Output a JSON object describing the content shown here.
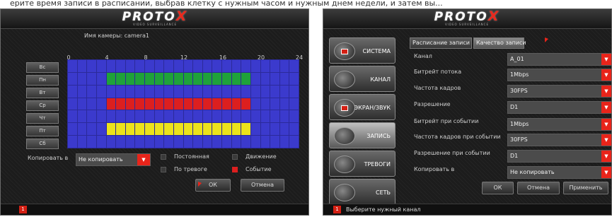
{
  "caption": "ерите время записи в расписании, выбрав клетку с нужным часом и нужным днем недели, и затем вы...",
  "brand": {
    "name": "PROTO",
    "mark": "X",
    "tagline": "VIDEO SURVEILLANCE"
  },
  "schedule_panel": {
    "camera_label": "Имя камеры: camera1",
    "hours": [
      "0",
      "4",
      "8",
      "12",
      "16",
      "20",
      "24"
    ],
    "days": [
      "Вс",
      "Пн",
      "Вт",
      "Ср",
      "Чт",
      "Пт",
      "Сб"
    ],
    "schedule_grid": {
      "hours_count": 24,
      "rows": [
        {
          "day": "Вс",
          "type": "none",
          "from": 0,
          "to": 0
        },
        {
          "day": "Пн",
          "type": "motion",
          "from": 4,
          "to": 19
        },
        {
          "day": "Вт",
          "type": "none",
          "from": 0,
          "to": 0
        },
        {
          "day": "Ср",
          "type": "event",
          "from": 4,
          "to": 19
        },
        {
          "day": "Чт",
          "type": "none",
          "from": 0,
          "to": 0
        },
        {
          "day": "Пт",
          "type": "alarm",
          "from": 4,
          "to": 19
        },
        {
          "day": "Сб",
          "type": "none",
          "from": 0,
          "to": 0
        }
      ]
    },
    "copy_label": "Копировать в",
    "copy_value": "Не копировать",
    "legend": {
      "constant": "Постоянная",
      "motion": "Движение",
      "alarm": "По тревоге",
      "event": "Событие"
    },
    "ok_label": "ОК",
    "cancel_label": "Отмена",
    "status_alarm": "1"
  },
  "settings_panel": {
    "tabs": [
      "Расписание записи",
      "Качество записи"
    ],
    "menu": [
      "СИСТЕМА",
      "КАНАЛ",
      "ЭКРАН/ЗВУК",
      "ЗАПИСЬ",
      "ТРЕВОГИ",
      "СЕТЬ"
    ],
    "fields": [
      {
        "label": "Канал",
        "value": "A_01"
      },
      {
        "label": "Битрейт потока",
        "value": "1Mbps"
      },
      {
        "label": "Частота кадров",
        "value": "30FPS"
      },
      {
        "label": "Разрешение",
        "value": "D1"
      },
      {
        "label": "Битрейт при событии",
        "value": "1Mbps"
      },
      {
        "label": "Частота  кадров при событии",
        "value": "30FPS"
      },
      {
        "label": "Разрешение при событии",
        "value": "D1"
      },
      {
        "label": "Копировать в",
        "value": "Не копировать"
      }
    ],
    "ok_label": "ОК",
    "cancel_label": "Отмена",
    "apply_label": "Применить",
    "status_alarm": "1",
    "status_text": "Выберите нужный канал"
  },
  "colors": {
    "motion": "#1fa23a",
    "event": "#dc1f1f",
    "alarm": "#ece31b",
    "none": "#3b3acd",
    "accent": "#e8241a"
  }
}
